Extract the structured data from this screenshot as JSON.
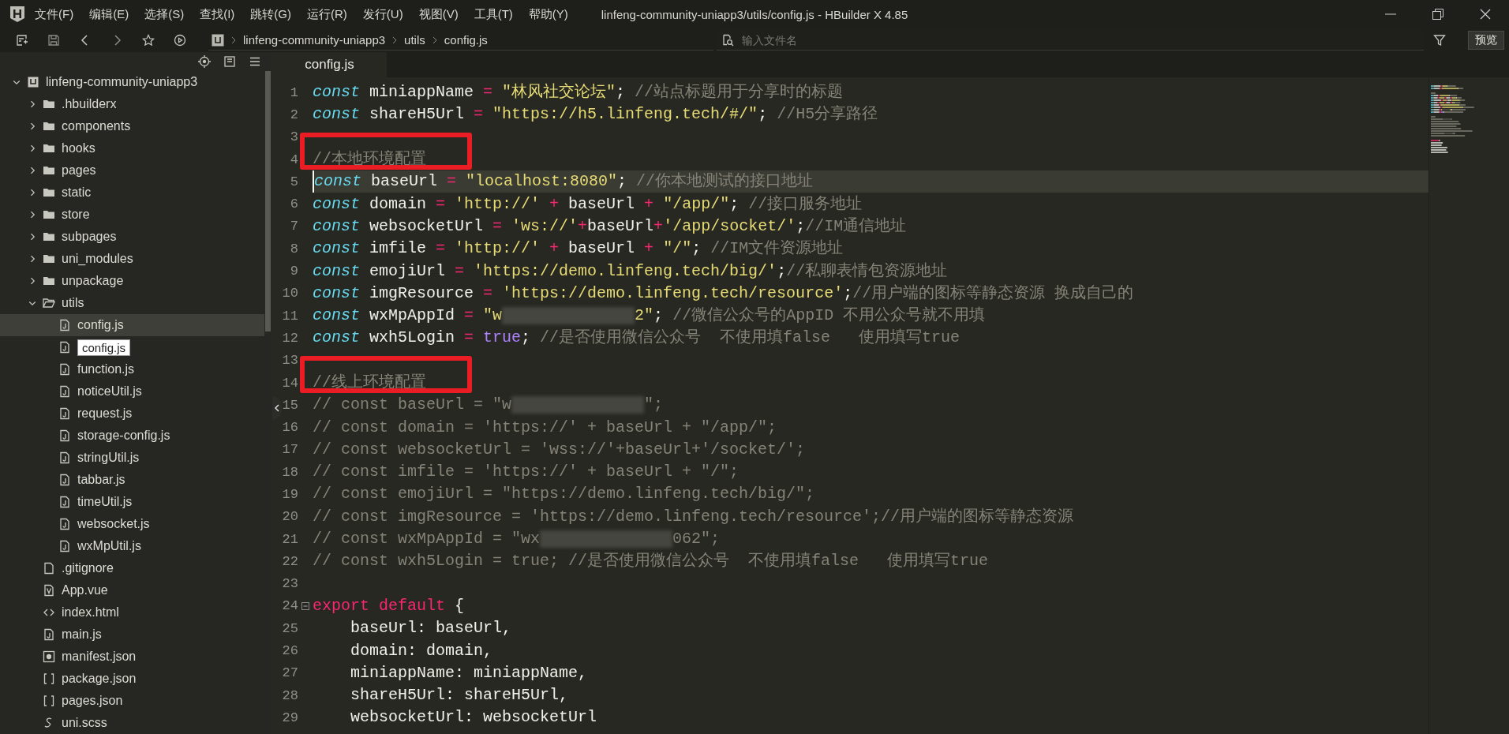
{
  "window": {
    "title": "linfeng-community-uniapp3/utils/config.js - HBuilder X 4.85"
  },
  "menu": [
    "文件(F)",
    "编辑(E)",
    "选择(S)",
    "查找(I)",
    "跳转(G)",
    "运行(R)",
    "发行(U)",
    "视图(V)",
    "工具(T)",
    "帮助(Y)"
  ],
  "breadcrumb": [
    "linfeng-community-uniapp3",
    "utils",
    "config.js"
  ],
  "search": {
    "placeholder": "输入文件名"
  },
  "preview_button": "预览",
  "tree": [
    {
      "kind": "project",
      "name": "linfeng-community-uniapp3",
      "expanded": true,
      "selected": false,
      "children": [
        {
          "kind": "folder",
          "name": ".hbuilderx",
          "expanded": false,
          "selected": false
        },
        {
          "kind": "folder",
          "name": "components",
          "expanded": false,
          "selected": false
        },
        {
          "kind": "folder",
          "name": "hooks",
          "expanded": false,
          "selected": false
        },
        {
          "kind": "folder",
          "name": "pages",
          "expanded": false,
          "selected": false
        },
        {
          "kind": "folder",
          "name": "static",
          "expanded": false,
          "selected": false
        },
        {
          "kind": "folder",
          "name": "store",
          "expanded": false,
          "selected": false
        },
        {
          "kind": "folder",
          "name": "subpages",
          "expanded": false,
          "selected": false
        },
        {
          "kind": "folder",
          "name": "uni_modules",
          "expanded": false,
          "selected": false
        },
        {
          "kind": "folder",
          "name": "unpackage",
          "expanded": false,
          "selected": false
        },
        {
          "kind": "folder",
          "name": "utils",
          "expanded": true,
          "selected": false,
          "children": [
            {
              "kind": "js",
              "name": "config.js",
              "selected": true
            },
            {
              "kind": "js",
              "tooltip": "config.js",
              "selected": false
            },
            {
              "kind": "js",
              "name": "function.js",
              "selected": false
            },
            {
              "kind": "js",
              "name": "noticeUtil.js",
              "selected": false
            },
            {
              "kind": "js",
              "name": "request.js",
              "selected": false
            },
            {
              "kind": "js",
              "name": "storage-config.js",
              "selected": false
            },
            {
              "kind": "js",
              "name": "stringUtil.js",
              "selected": false
            },
            {
              "kind": "js",
              "name": "tabbar.js",
              "selected": false
            },
            {
              "kind": "js",
              "name": "timeUtil.js",
              "selected": false
            },
            {
              "kind": "js",
              "name": "websocket.js",
              "selected": false
            },
            {
              "kind": "js",
              "name": "wxMpUtil.js",
              "selected": false
            }
          ]
        },
        {
          "kind": "file",
          "name": ".gitignore",
          "selected": false
        },
        {
          "kind": "vue",
          "name": "App.vue",
          "selected": false
        },
        {
          "kind": "html",
          "name": "index.html",
          "selected": false
        },
        {
          "kind": "js",
          "name": "main.js",
          "selected": false
        },
        {
          "kind": "manifest",
          "name": "manifest.json",
          "selected": false
        },
        {
          "kind": "json",
          "name": "package.json",
          "selected": false
        },
        {
          "kind": "json",
          "name": "pages.json",
          "selected": false
        },
        {
          "kind": "scss",
          "name": "uni.scss",
          "selected": false
        }
      ]
    }
  ],
  "tabs": [
    {
      "label": "config.js",
      "selected": true
    }
  ],
  "editor": {
    "lines": [
      {
        "number": "1",
        "current": false,
        "marked": false,
        "tokens": [
          {
            "kind": "kw",
            "text": "const"
          },
          {
            "kind": "id",
            "text": " miniappName"
          },
          {
            "kind": "op",
            "text": " = "
          },
          {
            "kind": "str",
            "text": "\"林风社交论坛\""
          },
          {
            "kind": "id",
            "text": "; "
          },
          {
            "kind": "cm",
            "text": "//站点标题用于分享时的标题"
          }
        ]
      },
      {
        "number": "2",
        "current": false,
        "marked": false,
        "tokens": [
          {
            "kind": "kw",
            "text": "const"
          },
          {
            "kind": "id",
            "text": " shareH5Url"
          },
          {
            "kind": "op",
            "text": " = "
          },
          {
            "kind": "str",
            "text": "\"https://h5.linfeng.tech/#/\""
          },
          {
            "kind": "id",
            "text": "; "
          },
          {
            "kind": "cm",
            "text": "//H5分享路径"
          }
        ]
      },
      {
        "number": "3",
        "current": false,
        "marked": false
      },
      {
        "number": "4",
        "current": false,
        "marked": true,
        "tokens": [
          {
            "kind": "cm",
            "text": "//本地环境配置"
          }
        ]
      },
      {
        "number": "5",
        "current": true,
        "marked": false,
        "tokens": [
          {
            "kind": "kw",
            "text": "const"
          },
          {
            "kind": "id",
            "text": " baseUrl"
          },
          {
            "kind": "op",
            "text": " = "
          },
          {
            "kind": "str",
            "text": "\"localhost:8080\""
          },
          {
            "kind": "id",
            "text": "; "
          },
          {
            "kind": "cm",
            "text": "//你本地测试的接口地址"
          }
        ]
      },
      {
        "number": "6",
        "current": false,
        "marked": false,
        "tokens": [
          {
            "kind": "kw",
            "text": "const"
          },
          {
            "kind": "id",
            "text": " domain"
          },
          {
            "kind": "op",
            "text": " = "
          },
          {
            "kind": "str",
            "text": "'http://'"
          },
          {
            "kind": "op",
            "text": " + "
          },
          {
            "kind": "id",
            "text": "baseUrl"
          },
          {
            "kind": "op",
            "text": " + "
          },
          {
            "kind": "str",
            "text": "\"/app/\""
          },
          {
            "kind": "id",
            "text": "; "
          },
          {
            "kind": "cm",
            "text": "//接口服务地址"
          }
        ]
      },
      {
        "number": "7",
        "current": false,
        "marked": false,
        "tokens": [
          {
            "kind": "kw",
            "text": "const"
          },
          {
            "kind": "id",
            "text": " websocketUrl"
          },
          {
            "kind": "op",
            "text": " = "
          },
          {
            "kind": "str",
            "text": "'ws://'"
          },
          {
            "kind": "op",
            "text": "+"
          },
          {
            "kind": "id",
            "text": "baseUrl"
          },
          {
            "kind": "op",
            "text": "+"
          },
          {
            "kind": "str",
            "text": "'/app/socket/'"
          },
          {
            "kind": "id",
            "text": ";"
          },
          {
            "kind": "cm",
            "text": "//IM通信地址"
          }
        ]
      },
      {
        "number": "8",
        "current": false,
        "marked": false,
        "tokens": [
          {
            "kind": "kw",
            "text": "const"
          },
          {
            "kind": "id",
            "text": " imfile"
          },
          {
            "kind": "op",
            "text": " = "
          },
          {
            "kind": "str",
            "text": "'http://'"
          },
          {
            "kind": "op",
            "text": " + "
          },
          {
            "kind": "id",
            "text": "baseUrl"
          },
          {
            "kind": "op",
            "text": " + "
          },
          {
            "kind": "str",
            "text": "\"/\""
          },
          {
            "kind": "id",
            "text": "; "
          },
          {
            "kind": "cm",
            "text": "//IM文件资源地址"
          }
        ]
      },
      {
        "number": "9",
        "current": false,
        "marked": false,
        "tokens": [
          {
            "kind": "kw",
            "text": "const"
          },
          {
            "kind": "id",
            "text": " emojiUrl"
          },
          {
            "kind": "op",
            "text": " = "
          },
          {
            "kind": "str",
            "text": "'https://demo.linfeng.tech/big/'"
          },
          {
            "kind": "id",
            "text": ";"
          },
          {
            "kind": "cm",
            "text": "//私聊表情包资源地址"
          }
        ]
      },
      {
        "number": "10",
        "current": false,
        "marked": false,
        "tokens": [
          {
            "kind": "kw",
            "text": "const"
          },
          {
            "kind": "id",
            "text": " imgResource"
          },
          {
            "kind": "op",
            "text": " = "
          },
          {
            "kind": "str",
            "text": "'https://demo.linfeng.tech/resource'"
          },
          {
            "kind": "id",
            "text": ";"
          },
          {
            "kind": "cm",
            "text": "//用户端的图标等静态资源 换成自己的"
          }
        ]
      },
      {
        "number": "11",
        "current": false,
        "marked": false,
        "tokens": [
          {
            "kind": "kw",
            "text": "const"
          },
          {
            "kind": "id",
            "text": " wxMpAppId"
          },
          {
            "kind": "op",
            "text": " = "
          },
          {
            "kind": "str",
            "text": "\"w"
          },
          {
            "kind": "redacted"
          },
          {
            "kind": "str",
            "text": "2\""
          },
          {
            "kind": "id",
            "text": "; "
          },
          {
            "kind": "cm",
            "text": "//微信公众号的AppID 不用公众号就不用填"
          }
        ]
      },
      {
        "number": "12",
        "current": false,
        "marked": false,
        "tokens": [
          {
            "kind": "kw",
            "text": "const"
          },
          {
            "kind": "id",
            "text": " wxh5Login"
          },
          {
            "kind": "op",
            "text": " = "
          },
          {
            "kind": "bool",
            "text": "true"
          },
          {
            "kind": "id",
            "text": "; "
          },
          {
            "kind": "cm",
            "text": "//是否使用微信公众号  不使用填false   使用填写true"
          }
        ]
      },
      {
        "number": "13",
        "current": false,
        "marked": false
      },
      {
        "number": "14",
        "current": false,
        "marked": true,
        "tokens": [
          {
            "kind": "cm",
            "text": "//线上环境配置"
          }
        ]
      },
      {
        "number": "15",
        "current": false,
        "marked": false,
        "tokens": [
          {
            "kind": "cm",
            "text": "// const baseUrl = \"w"
          },
          {
            "kind": "redacted"
          },
          {
            "kind": "cm",
            "text": "\";"
          }
        ]
      },
      {
        "number": "16",
        "current": false,
        "marked": false,
        "tokens": [
          {
            "kind": "cm",
            "text": "// const domain = 'https://' + baseUrl + \"/app/\";"
          }
        ]
      },
      {
        "number": "17",
        "current": false,
        "marked": false,
        "tokens": [
          {
            "kind": "cm",
            "text": "// const websocketUrl = 'wss://'+baseUrl+'/socket/';"
          }
        ]
      },
      {
        "number": "18",
        "current": false,
        "marked": false,
        "tokens": [
          {
            "kind": "cm",
            "text": "// const imfile = 'https://' + baseUrl + \"/\";"
          }
        ]
      },
      {
        "number": "19",
        "current": false,
        "marked": false,
        "tokens": [
          {
            "kind": "cm",
            "text": "// const emojiUrl = \"https://demo.linfeng.tech/big/\";"
          }
        ]
      },
      {
        "number": "20",
        "current": false,
        "marked": false,
        "tokens": [
          {
            "kind": "cm",
            "text": "// const imgResource = 'https://demo.linfeng.tech/resource';//用户端的图标等静态资源"
          }
        ]
      },
      {
        "number": "21",
        "current": false,
        "marked": false,
        "tokens": [
          {
            "kind": "cm",
            "text": "// const wxMpAppId = \"wx"
          },
          {
            "kind": "redacted"
          },
          {
            "kind": "cm",
            "text": "062\";"
          }
        ]
      },
      {
        "number": "22",
        "current": false,
        "marked": false,
        "tokens": [
          {
            "kind": "cm",
            "text": "// const wxh5Login = true; //是否使用微信公众号  不使用填false   使用填写true"
          }
        ]
      },
      {
        "number": "23",
        "current": false,
        "marked": false
      },
      {
        "number": "24",
        "current": false,
        "marked": false,
        "fold": true,
        "tokens": [
          {
            "kind": "kw2",
            "text": "export default"
          },
          {
            "kind": "id",
            "text": " {"
          }
        ]
      },
      {
        "number": "25",
        "current": false,
        "marked": false,
        "tokens": [
          {
            "kind": "id",
            "text": "    baseUrl: baseUrl,"
          }
        ]
      },
      {
        "number": "26",
        "current": false,
        "marked": false,
        "tokens": [
          {
            "kind": "id",
            "text": "    domain: domain,"
          }
        ]
      },
      {
        "number": "27",
        "current": false,
        "marked": false,
        "tokens": [
          {
            "kind": "id",
            "text": "    miniappName: miniappName,"
          }
        ]
      },
      {
        "number": "28",
        "current": false,
        "marked": false,
        "tokens": [
          {
            "kind": "id",
            "text": "    shareH5Url: shareH5Url,"
          }
        ]
      },
      {
        "number": "29",
        "current": false,
        "marked": false,
        "tokens": [
          {
            "kind": "id",
            "text": "    websocketUrl: websocketUrl"
          }
        ]
      }
    ]
  }
}
